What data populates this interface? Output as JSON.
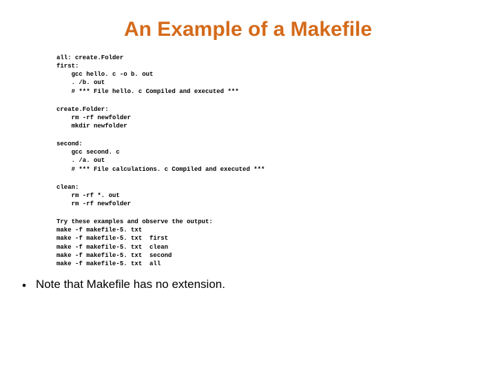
{
  "title": "An Example of a Makefile",
  "code": {
    "block1": "all: create.Folder\nfirst:\n    gcc hello. c -o b. out\n    . /b. out\n    # *** File hello. c Compiled and executed ***",
    "block2": "create.Folder:\n    rm -rf newfolder\n    mkdir newfolder",
    "block3": "second:\n    gcc second. c\n    . /a. out\n    # *** File calculations. c Compiled and executed ***",
    "block4": "clean:\n    rm -rf *. out\n    rm -rf newfolder",
    "block5": "Try these examples and observe the output:\nmake -f makefile-5. txt\nmake -f makefile-5. txt  first\nmake -f makefile-5. txt  clean\nmake -f makefile-5. txt  second\nmake -f makefile-5. txt  all"
  },
  "bullet_char": "•",
  "note": "Note that Makefile has no extension."
}
